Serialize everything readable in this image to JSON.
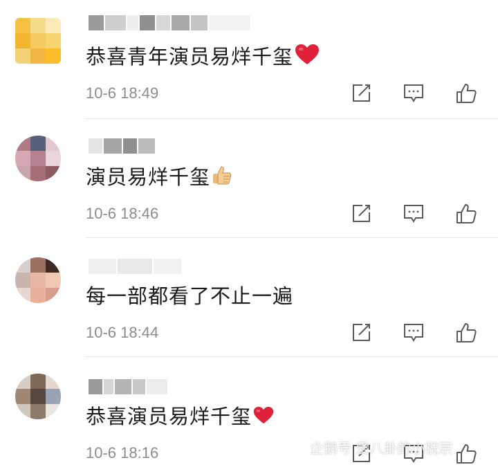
{
  "comments": [
    {
      "text": "恭喜青年演员易烊千玺",
      "emoji": "heart-icon",
      "time": "10-6 18:49"
    },
    {
      "text": "演员易烊千玺",
      "emoji": "thumbs-up-emoji-icon",
      "time": "10-6 18:46"
    },
    {
      "text": "每一部都看了不止一遍",
      "emoji": "",
      "time": "10-6 18:44"
    },
    {
      "text": "恭喜演员易烊千玺",
      "emoji": "heart-icon",
      "time": "10-6 18:16"
    }
  ],
  "actions": [
    "edit-icon",
    "comment-icon",
    "like-icon"
  ],
  "watermark": {
    "text": "企鹅号 爱八卦的小祝宗"
  },
  "colors": {
    "heart": "#e0213a",
    "icon": "#5a5a5a",
    "time": "#8c8c8c"
  }
}
